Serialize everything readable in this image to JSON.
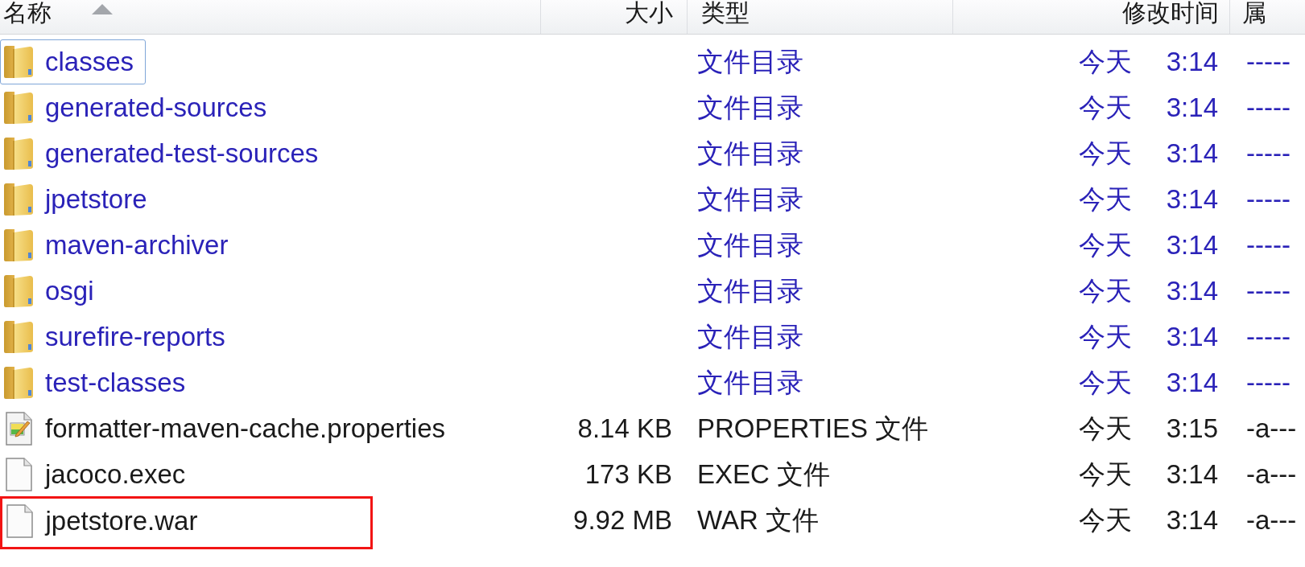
{
  "header": {
    "columns": [
      {
        "label": "名称",
        "sorted": true
      },
      {
        "label": "大小",
        "sorted": false
      },
      {
        "label": "类型",
        "sorted": false
      },
      {
        "label": "修改时间",
        "sorted": false
      },
      {
        "label": "属",
        "sorted": false
      }
    ]
  },
  "rows": [
    {
      "kind": "folder",
      "name": "classes",
      "type": "文件目录",
      "modified": "今天 3:14",
      "attributes": "-----",
      "focused": true,
      "highlighted": false
    },
    {
      "kind": "folder",
      "name": "generated-sources",
      "type": "文件目录",
      "modified": "今天 3:14",
      "attributes": "-----",
      "focused": false,
      "highlighted": false
    },
    {
      "kind": "folder",
      "name": "generated-test-sources",
      "type": "文件目录",
      "modified": "今天 3:14",
      "attributes": "-----",
      "focused": false,
      "highlighted": false
    },
    {
      "kind": "folder",
      "name": "jpetstore",
      "type": "文件目录",
      "modified": "今天 3:14",
      "attributes": "-----",
      "focused": false,
      "highlighted": false
    },
    {
      "kind": "folder",
      "name": "maven-archiver",
      "type": "文件目录",
      "modified": "今天 3:14",
      "attributes": "-----",
      "focused": false,
      "highlighted": false
    },
    {
      "kind": "folder",
      "name": "osgi",
      "type": "文件目录",
      "modified": "今天 3:14",
      "attributes": "-----",
      "focused": false,
      "highlighted": false
    },
    {
      "kind": "folder",
      "name": "surefire-reports",
      "type": "文件目录",
      "modified": "今天 3:14",
      "attributes": "-----",
      "focused": false,
      "highlighted": false
    },
    {
      "kind": "folder",
      "name": "test-classes",
      "type": "文件目录",
      "modified": "今天 3:14",
      "attributes": "-----",
      "focused": false,
      "highlighted": false
    },
    {
      "kind": "properties",
      "name": "formatter-maven-cache.properties",
      "size": "8.14 KB",
      "type": "PROPERTIES 文件",
      "modified": "今天 3:15",
      "attributes": "-a---",
      "focused": false,
      "highlighted": false
    },
    {
      "kind": "file",
      "name": "jacoco.exec",
      "size": "173 KB",
      "type": "EXEC 文件",
      "modified": "今天 3:14",
      "attributes": "-a---",
      "focused": false,
      "highlighted": false
    },
    {
      "kind": "file",
      "name": "jpetstore.war",
      "size": "9.92 MB",
      "type": "WAR 文件",
      "modified": "今天 3:14",
      "attributes": "-a---",
      "focused": false,
      "highlighted": true
    }
  ]
}
